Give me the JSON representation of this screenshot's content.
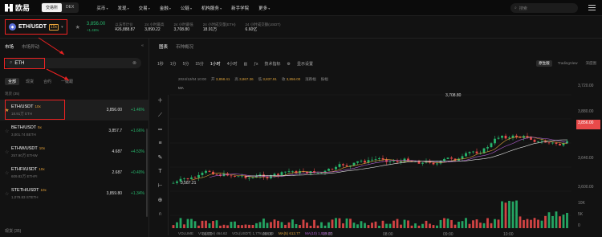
{
  "nav": {
    "logo": "欧易",
    "segments": [
      "交易所",
      "DEX"
    ],
    "items": [
      "买币",
      "发现",
      "交易",
      "金融",
      "公链",
      "机构服务",
      "新手学院",
      "更多"
    ],
    "search_placeholder": "搜索"
  },
  "ticker": {
    "pair": "ETH/USDT",
    "leverage": "10x",
    "price": "3,856.00",
    "change": "+1.46%",
    "stats": [
      {
        "k": "以法币计价",
        "v": "¥26,888.87"
      },
      {
        "k": "24 小时最高",
        "v": "3,890.22"
      },
      {
        "k": "24 小时最低",
        "v": "3,708.80"
      },
      {
        "k": "24 小时成交量(ETH)",
        "v": "18.91万"
      },
      {
        "k": "24 小时成交额(USDT)",
        "v": "6.60亿"
      }
    ]
  },
  "left": {
    "tabs": [
      "市场",
      "市场异动"
    ],
    "search_value": "ETH",
    "filters": [
      "全部",
      "现货",
      "合约",
      "一键跟"
    ],
    "header": [
      "现货 (35)",
      "",
      ""
    ],
    "rows": [
      {
        "name": "ETH/USDT",
        "lev": "10x",
        "sub": "18.91万 ETH",
        "price": "3,856.00",
        "chg": "+1.46%",
        "up": true
      },
      {
        "name": "BETH/USDT",
        "lev": "5x",
        "sub": "3,001.74 BETH",
        "price": "3,857.7",
        "chg": "+1.66%",
        "up": true
      },
      {
        "name": "ETHW/USDT",
        "lev": "10x",
        "sub": "257.90万 ETHW",
        "price": "4.687",
        "chg": "+4.53%",
        "up": true
      },
      {
        "name": "ETHFI/USDT",
        "lev": "10x",
        "sub": "609.82万 ETHFI",
        "price": "2.687",
        "chg": "+0.40%",
        "up": true
      },
      {
        "name": "STETH/USDT",
        "lev": "10x",
        "sub": "1,079.83 STETH",
        "price": "3,859.80",
        "chg": "+1.34%",
        "up": true
      }
    ],
    "footer": "现货 (35)"
  },
  "chart": {
    "tabs": [
      "图表",
      "币种概况"
    ],
    "intervals": [
      "1秒",
      "1分",
      "5分",
      "15分",
      "1小时",
      "4小时"
    ],
    "tools": [
      "技术指标",
      "显示设置"
    ],
    "views": [
      "原生版",
      "TradingView",
      "深度图"
    ],
    "ohlc": {
      "date": "2024/12/04 10:00",
      "open": "3,858.41",
      "high": "3,867.36",
      "low": "3,837.91",
      "close": "3,856.00",
      "chg": "涨跌幅",
      "amp": "振幅"
    },
    "ma_label": "MA",
    "price_labels": [
      "3,720.00",
      "3,880.00",
      "3,856.00",
      "3,640.00",
      "3,600.00"
    ],
    "volume_legend": {
      "label": "VOLUME",
      "v1": "VOL(ETH) 464.62",
      "v2": "VOL(USDT) 1,778,458.60",
      "ma5": "MA(5) 613.77",
      "ma10": "MA(10) 1,006.37"
    },
    "vol_axis": [
      "10K",
      "5K",
      "0"
    ],
    "time_labels": [
      "06:00",
      "06:00",
      "07:00",
      "08:00",
      "09:00",
      "10:00"
    ],
    "annot_high": "3,708.80",
    "annot_low": "3,587.21",
    "colors": {
      "up": "#27b66c",
      "down": "#e84a4a",
      "accent": "#e8a33a"
    }
  }
}
